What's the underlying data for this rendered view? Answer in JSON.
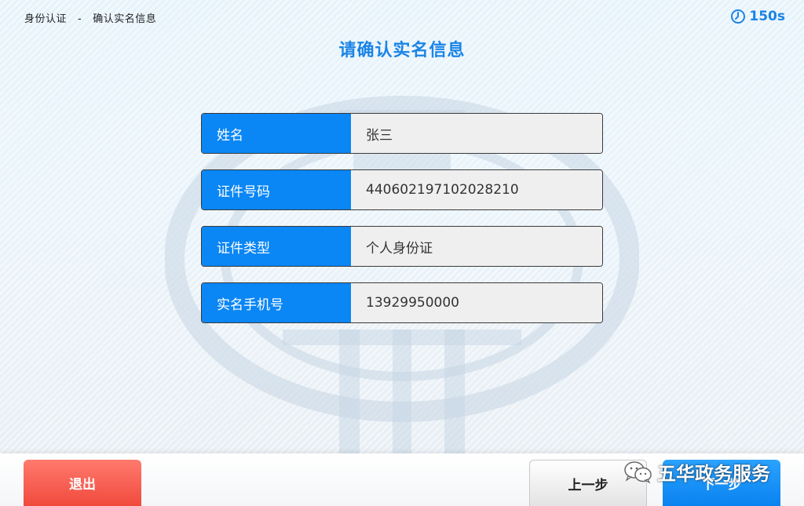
{
  "breadcrumb": {
    "step1": "身份认证",
    "separator": "-",
    "step2": "确认实名信息"
  },
  "timer": {
    "icon": "clock-icon",
    "value": "150s"
  },
  "page_title": "请确认实名信息",
  "fields": [
    {
      "label": "姓名",
      "value": "张三"
    },
    {
      "label": "证件号码",
      "value": "440602197102028210"
    },
    {
      "label": "证件类型",
      "value": "个人身份证"
    },
    {
      "label": "实名手机号",
      "value": "13929950000"
    }
  ],
  "footer": {
    "exit_label": "退出",
    "prev_label": "上一步",
    "next_label": "下一步"
  },
  "watermark": {
    "icon": "wechat-icon",
    "text": "五华政务服务"
  },
  "colors": {
    "accent": "#0a86f5",
    "exit": "#f04a3c"
  }
}
